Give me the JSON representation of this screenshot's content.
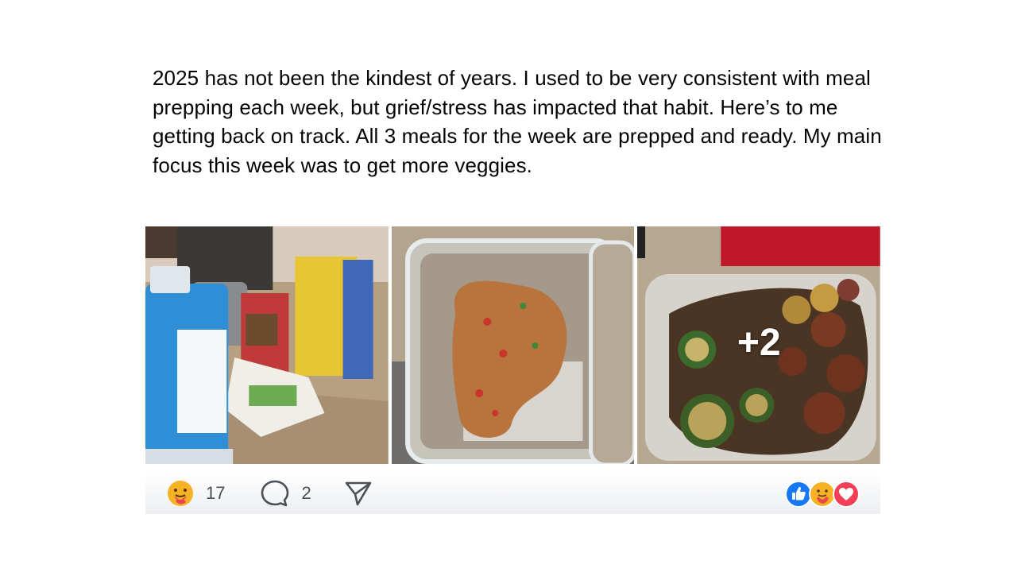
{
  "post": {
    "text": "2025 has not been the kindest of years. I used to be very consistent with meal prepping each week, but grief/stress has impacted that habit. Here’s to me getting back on track. All 3 meals for the week are prepped and ready. My main focus this week was to get more veggies."
  },
  "photos": {
    "items": [
      {
        "icon": "groceries-photo"
      },
      {
        "icon": "rice-meal-prep-photo"
      },
      {
        "icon": "zucchini-sausage-photo"
      }
    ],
    "more_label": "+2"
  },
  "actions": {
    "reaction_icon": "care-reaction-icon",
    "reaction_count": "17",
    "comment_icon": "comment-icon",
    "comment_count": "2",
    "share_icon": "share-icon"
  },
  "reaction_summary": [
    {
      "icon": "like-reaction-icon",
      "color": "#1877f2"
    },
    {
      "icon": "care-reaction-icon",
      "color": "#f7b125"
    },
    {
      "icon": "love-reaction-icon",
      "color": "#f33e58"
    }
  ]
}
